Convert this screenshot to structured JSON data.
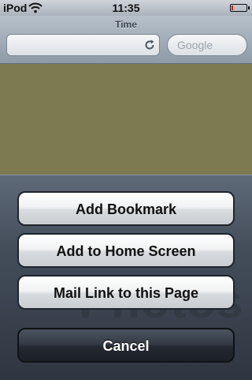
{
  "status_bar": {
    "carrier": "iPod",
    "time": "11:35"
  },
  "browser": {
    "title": "Time",
    "url": "",
    "search_placeholder": "Google"
  },
  "action_sheet": {
    "background_text": "Photos",
    "buttons": [
      {
        "label": "Add Bookmark"
      },
      {
        "label": "Add to Home Screen"
      },
      {
        "label": "Mail Link to this Page"
      }
    ],
    "cancel_label": "Cancel"
  },
  "colors": {
    "page_background": "#7d7a52",
    "battery_low": "#cc2222"
  }
}
